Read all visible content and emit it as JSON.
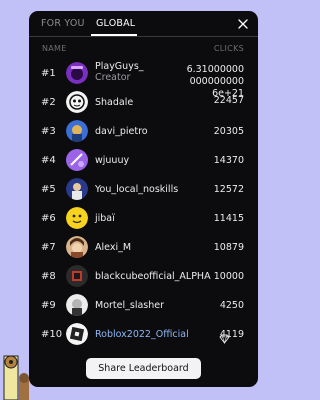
{
  "tabs": {
    "for_you": "FOR YOU",
    "global": "GLOBAL"
  },
  "header": {
    "name": "NAME",
    "clicks": "CLICKS"
  },
  "rows": [
    {
      "rank": "#1",
      "name": "PlayGuys_",
      "subtitle": "Creator",
      "score": "6.310000000000000006e+21",
      "score_overlap": "22457"
    },
    {
      "rank": "#2",
      "name": "Shadale",
      "score": ""
    },
    {
      "rank": "#3",
      "name": "davi_pietro",
      "score": "20305"
    },
    {
      "rank": "#4",
      "name": "wjuuuy",
      "score": "14370"
    },
    {
      "rank": "#5",
      "name": "You_local_noskills",
      "score": "12572"
    },
    {
      "rank": "#6",
      "name": "jibaï",
      "score": "11415"
    },
    {
      "rank": "#7",
      "name": "Alexi_M",
      "score": "10879"
    },
    {
      "rank": "#8",
      "name": "blackcubeofficial_ALPHA",
      "score": "10000"
    },
    {
      "rank": "#9",
      "name": "Mortel_slasher",
      "score": "4250"
    },
    {
      "rank": "#10",
      "name": "Roblox2022_Official",
      "score": "4119"
    }
  ],
  "share_button": "Share Leaderboard",
  "colors": {
    "background": "#c1c1f7",
    "panel": "#0c0c0e",
    "special_name": "#8eb8f5"
  }
}
